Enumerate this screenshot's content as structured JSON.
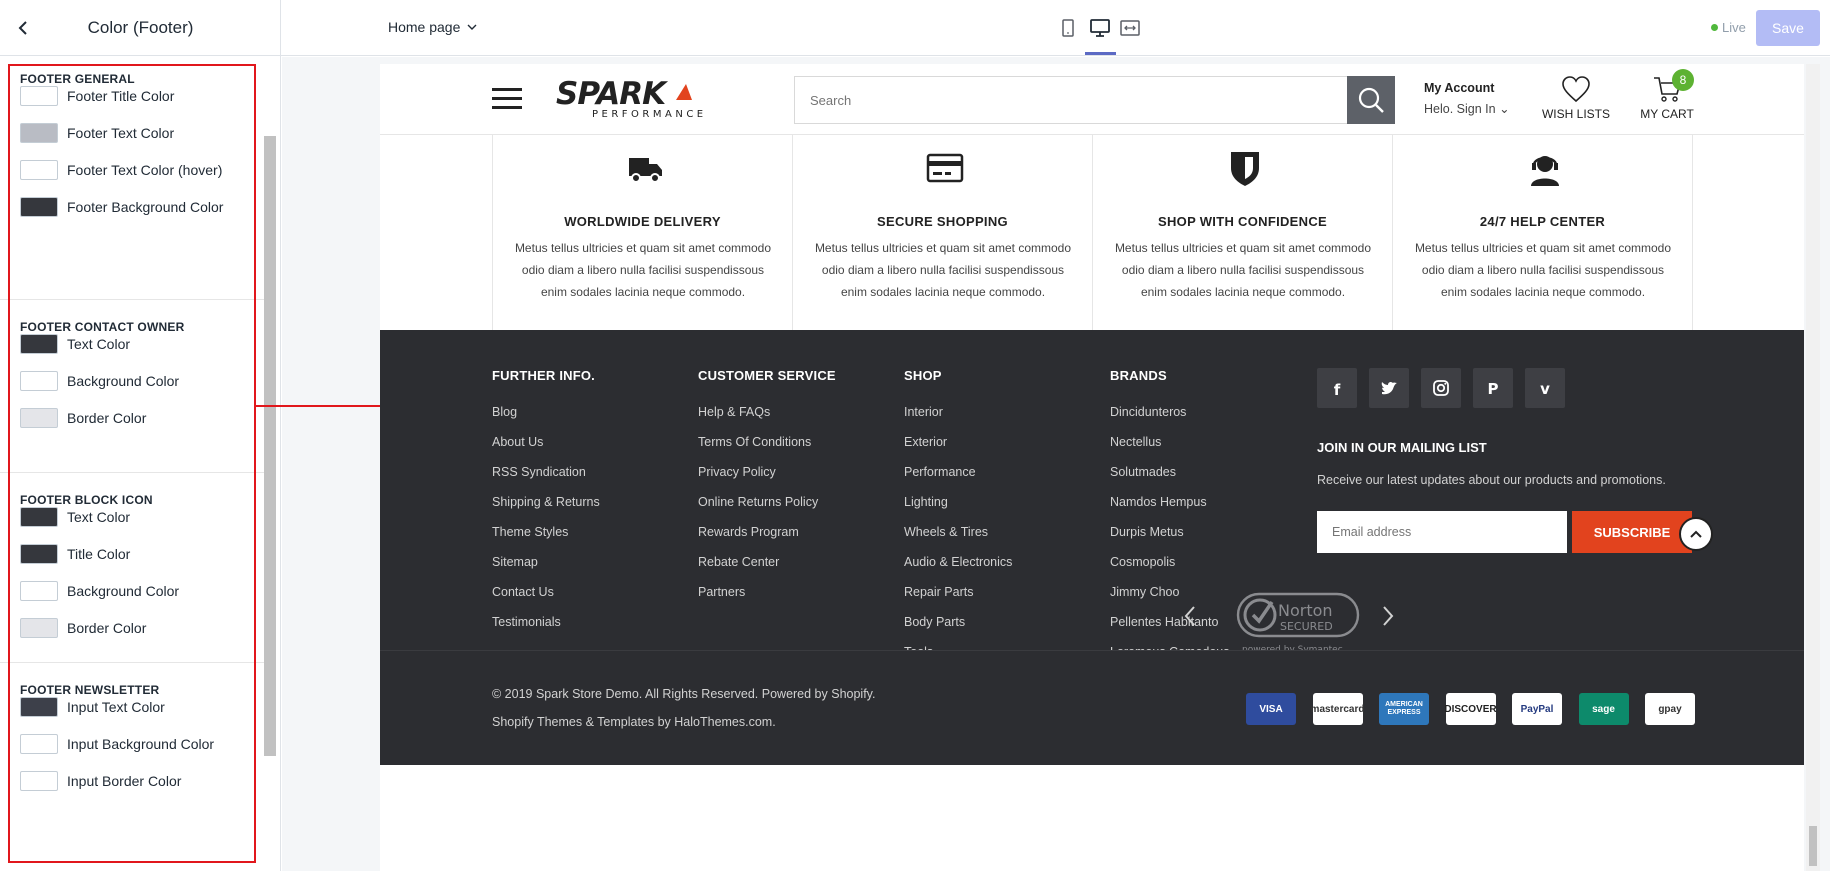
{
  "topbar": {
    "panel_title": "Color (Footer)",
    "page_selector": "Home page",
    "live_label": "Live",
    "save_label": "Save"
  },
  "sidebar": {
    "sections": [
      {
        "title": "FOOTER GENERAL",
        "items": [
          {
            "label": "Footer Title Color",
            "color": "#ffffff"
          },
          {
            "label": "Footer Text Color",
            "color": "#b9bcc4"
          },
          {
            "label": "Footer Text Color (hover)",
            "color": "#ffffff"
          },
          {
            "label": "Footer Background Color",
            "color": "#35373d"
          }
        ]
      },
      {
        "title": "FOOTER CONTACT OWNER",
        "items": [
          {
            "label": "Text Color",
            "color": "#35373d"
          },
          {
            "label": "Background Color",
            "color": "#ffffff"
          },
          {
            "label": "Border Color",
            "color": "#e4e5e9"
          }
        ]
      },
      {
        "title": "FOOTER BLOCK ICON",
        "items": [
          {
            "label": "Text Color",
            "color": "#35373d"
          },
          {
            "label": "Title Color",
            "color": "#35373d"
          },
          {
            "label": "Background Color",
            "color": "#ffffff"
          },
          {
            "label": "Border Color",
            "color": "#e4e5e9"
          }
        ]
      },
      {
        "title": "FOOTER NEWSLETTER",
        "items": [
          {
            "label": "Input Text Color",
            "color": "#3d404a"
          },
          {
            "label": "Input Background Color",
            "color": "#ffffff"
          },
          {
            "label": "Input Border Color",
            "color": "#ffffff"
          }
        ]
      }
    ]
  },
  "store": {
    "logo": {
      "brand": "SPARK",
      "tagline": "PERFORMANCE"
    },
    "search_placeholder": "Search",
    "account": {
      "title": "My Account",
      "sub": "Helo. Sign In"
    },
    "wishlist_label": "WISH LISTS",
    "cart_label": "MY CART",
    "cart_count": "8",
    "features": [
      {
        "title": "WORLDWIDE DELIVERY",
        "icon": "truck-icon",
        "desc": "Metus tellus ultricies et quam sit amet commodo odio diam a libero nulla facilisi suspendissous enim sodales lacinia neque commodo."
      },
      {
        "title": "SECURE SHOPPING",
        "icon": "credit-card-icon",
        "desc": "Metus tellus ultricies et quam sit amet commodo odio diam a libero nulla facilisi suspendissous enim sodales lacinia neque commodo."
      },
      {
        "title": "SHOP WITH CONFIDENCE",
        "icon": "shield-icon",
        "desc": "Metus tellus ultricies et quam sit amet commodo odio diam a libero nulla facilisi suspendissous enim sodales lacinia neque commodo."
      },
      {
        "title": "24/7 HELP CENTER",
        "icon": "headset-icon",
        "desc": "Metus tellus ultricies et quam sit amet commodo odio diam a libero nulla facilisi suspendissous enim sodales lacinia neque commodo."
      }
    ],
    "footer": {
      "columns": [
        {
          "title": "FURTHER INFO.",
          "links": [
            "Blog",
            "About Us",
            "RSS Syndication",
            "Shipping & Returns",
            "Theme Styles",
            "Sitemap",
            "Contact Us",
            "Testimonials"
          ]
        },
        {
          "title": "CUSTOMER SERVICE",
          "links": [
            "Help & FAQs",
            "Terms Of Conditions",
            "Privacy Policy",
            "Online Returns Policy",
            "Rewards Program",
            "Rebate Center",
            "Partners"
          ]
        },
        {
          "title": "SHOP",
          "links": [
            "Interior",
            "Exterior",
            "Performance",
            "Lighting",
            "Wheels & Tires",
            "Audio & Electronics",
            "Repair Parts",
            "Body Parts",
            "Tools"
          ]
        },
        {
          "title": "BRANDS",
          "links": [
            "Dincidunteros",
            "Nectellus",
            "Solutmades",
            "Namdos Hempus",
            "Durpis Metus",
            "Cosmopolis",
            "Jimmy Choo",
            "Pellentes Habitanto",
            "Loremous Comodous"
          ]
        }
      ],
      "social": [
        "facebook-icon",
        "twitter-icon",
        "instagram-icon",
        "pinterest-icon",
        "vimeo-icon"
      ],
      "newsletter": {
        "title": "JOIN IN OUR MAILING LIST",
        "desc": "Receive our latest updates about our products and promotions.",
        "placeholder": "Email address",
        "button": "SUBSCRIBE"
      },
      "norton": {
        "line1": "Norton",
        "line2": "SECURED",
        "line3": "powered by Symantec"
      },
      "copyright": "© 2019 Spark Store Demo. All Rights Reserved. Powered by Shopify.",
      "credits": "Shopify Themes & Templates by HaloThemes.com.",
      "payments": [
        {
          "name": "VISA",
          "bg": "#2f4c9e",
          "fg": "#ffffff"
        },
        {
          "name": "mastercard",
          "bg": "#ffffff",
          "fg": "#333333"
        },
        {
          "name": "AMERICAN EXPRESS",
          "bg": "#2e77bb",
          "fg": "#ffffff"
        },
        {
          "name": "DISCOVER",
          "bg": "#ffffff",
          "fg": "#222222"
        },
        {
          "name": "PayPal",
          "bg": "#ffffff",
          "fg": "#253b80"
        },
        {
          "name": "sage",
          "bg": "#0d8a6b",
          "fg": "#ffffff"
        },
        {
          "name": "gpay",
          "bg": "#ffffff",
          "fg": "#333333"
        }
      ]
    }
  }
}
